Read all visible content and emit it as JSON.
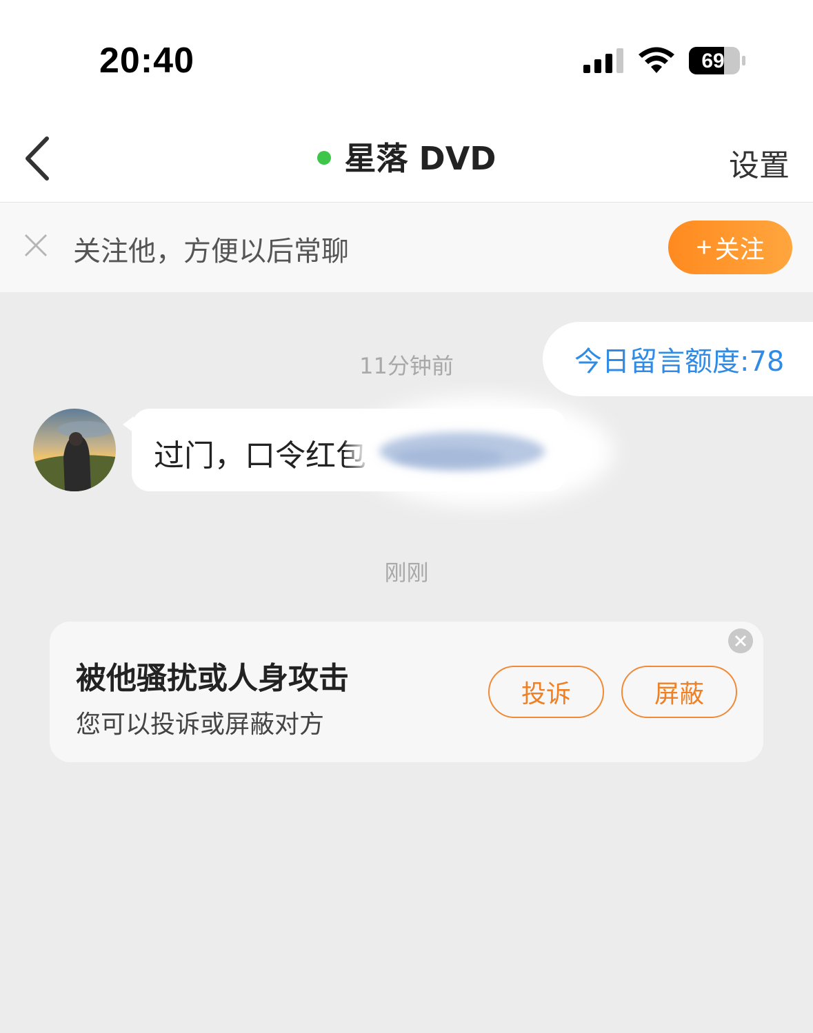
{
  "status_bar": {
    "time": "20:40",
    "battery": "69",
    "signal_icon": "cellular-signal-icon",
    "wifi_icon": "wifi-icon"
  },
  "nav": {
    "title": "星落 DVD",
    "settings_label": "设置",
    "back_icon": "chevron-left-icon",
    "online_color": "#3ec64a"
  },
  "follow_bar": {
    "text": "关注他，方便以后常聊",
    "button_label": "关注",
    "button_plus": "+",
    "accent": "#ff8a1f"
  },
  "quota": {
    "text": "今日留言额度:78",
    "color": "#2f8be6"
  },
  "messages": [
    {
      "time": "11分钟前",
      "text": "过门，口令红包"
    }
  ],
  "notice_time": "刚刚",
  "report_card": {
    "title": "被他骚扰或人身攻击",
    "subtitle": "您可以投诉或屏蔽对方",
    "complain_label": "投诉",
    "block_label": "屏蔽",
    "accent": "#ee8126"
  }
}
